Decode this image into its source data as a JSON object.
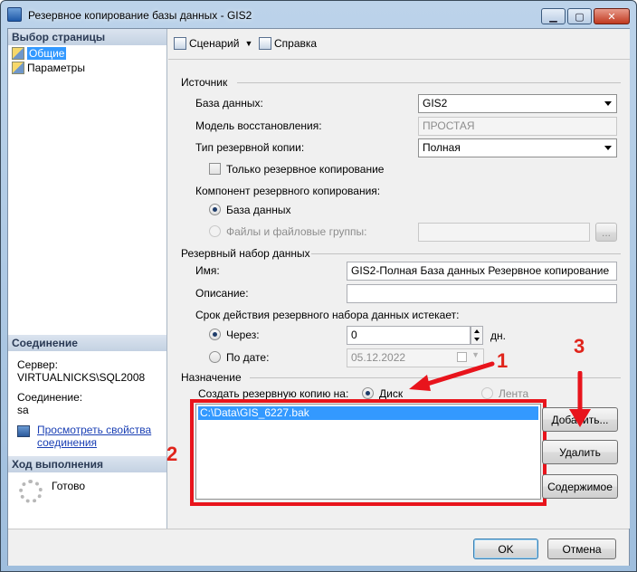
{
  "window": {
    "title": "Резервное копирование базы данных - GIS2"
  },
  "left_pane": {
    "page_select_header": "Выбор страницы",
    "pages": [
      {
        "label": "Общие",
        "selected": true
      },
      {
        "label": "Параметры",
        "selected": false
      }
    ],
    "connection_header": "Соединение",
    "server_label": "Сервер:",
    "server_value": "VIRTUALNICKS\\SQL2008",
    "connection_label": "Соединение:",
    "connection_value": "sa",
    "view_properties_link_line1": "Просмотреть свойства",
    "view_properties_link_line2": "соединения",
    "progress_header": "Ход выполнения",
    "progress_status": "Готово"
  },
  "toolbar": {
    "script_label": "Сценарий",
    "help_label": "Справка"
  },
  "source": {
    "section_label": "Источник",
    "database_label": "База данных:",
    "database_value": "GIS2",
    "recovery_model_label": "Модель восстановления:",
    "recovery_model_value": "ПРОСТАЯ",
    "backup_type_label": "Тип резервной копии:",
    "backup_type_value": "Полная",
    "copy_only_label": "Только резервное копирование",
    "component_label": "Компонент резервного копирования:",
    "component_database_label": "База данных",
    "component_files_label": "Файлы и файловые группы:",
    "browse_button": "..."
  },
  "backup_set": {
    "section_label": "Резервный набор данных",
    "name_label": "Имя:",
    "name_value": "GIS2-Полная База данных Резервное копирование",
    "description_label": "Описание:",
    "description_value": "",
    "expires_label": "Срок действия резервного набора данных истекает:",
    "after_label": "Через:",
    "after_value": "0",
    "days_label": "дн.",
    "on_label": "По дате:",
    "on_value": "05.12.2022"
  },
  "destination": {
    "section_label": "Назначение",
    "backup_to_label": "Создать резервную копию на:",
    "disk_label": "Диск",
    "tape_label": "Лента",
    "files": [
      "C:\\Data\\GIS_6227.bak"
    ],
    "add_button": "Добавить...",
    "remove_button": "Удалить",
    "contents_button": "Содержимое"
  },
  "annotations": {
    "one": "1",
    "two": "2",
    "three": "3"
  },
  "footer": {
    "ok_button": "OK",
    "cancel_button": "Отмена"
  },
  "colors": {
    "highlight": "#3399ff",
    "annotation_red": "#e8141c"
  }
}
